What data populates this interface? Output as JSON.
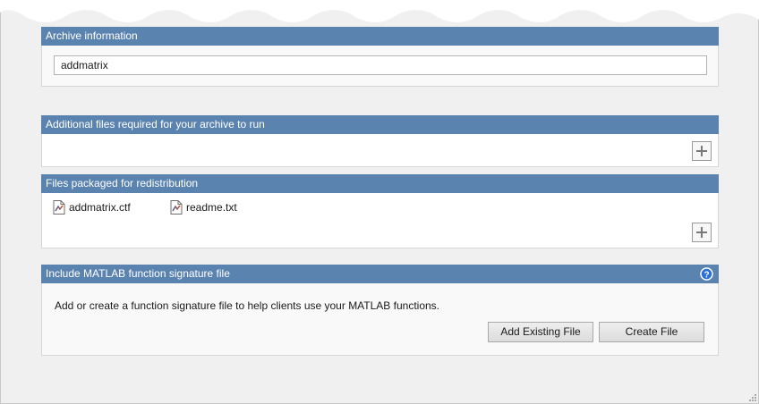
{
  "archive_info": {
    "header": "Archive information",
    "name_value": "addmatrix"
  },
  "additional_files": {
    "header": "Additional files required for your archive to run",
    "add_icon": "plus-icon"
  },
  "packaged_files": {
    "header": "Files packaged for redistribution",
    "files": [
      {
        "name": "addmatrix.ctf",
        "icon": "file-icon"
      },
      {
        "name": "readme.txt",
        "icon": "file-icon"
      }
    ],
    "add_icon": "plus-icon"
  },
  "signature": {
    "header": "Include MATLAB function signature file",
    "help_icon": "help-icon",
    "description": "Add or create a function signature file to help clients use your MATLAB functions.",
    "add_existing_label": "Add Existing File",
    "create_label": "Create File"
  },
  "colors": {
    "header_bg": "#5b83b0",
    "panel_bg": "#f9f9f9",
    "help_icon": "#2a6fd6"
  }
}
